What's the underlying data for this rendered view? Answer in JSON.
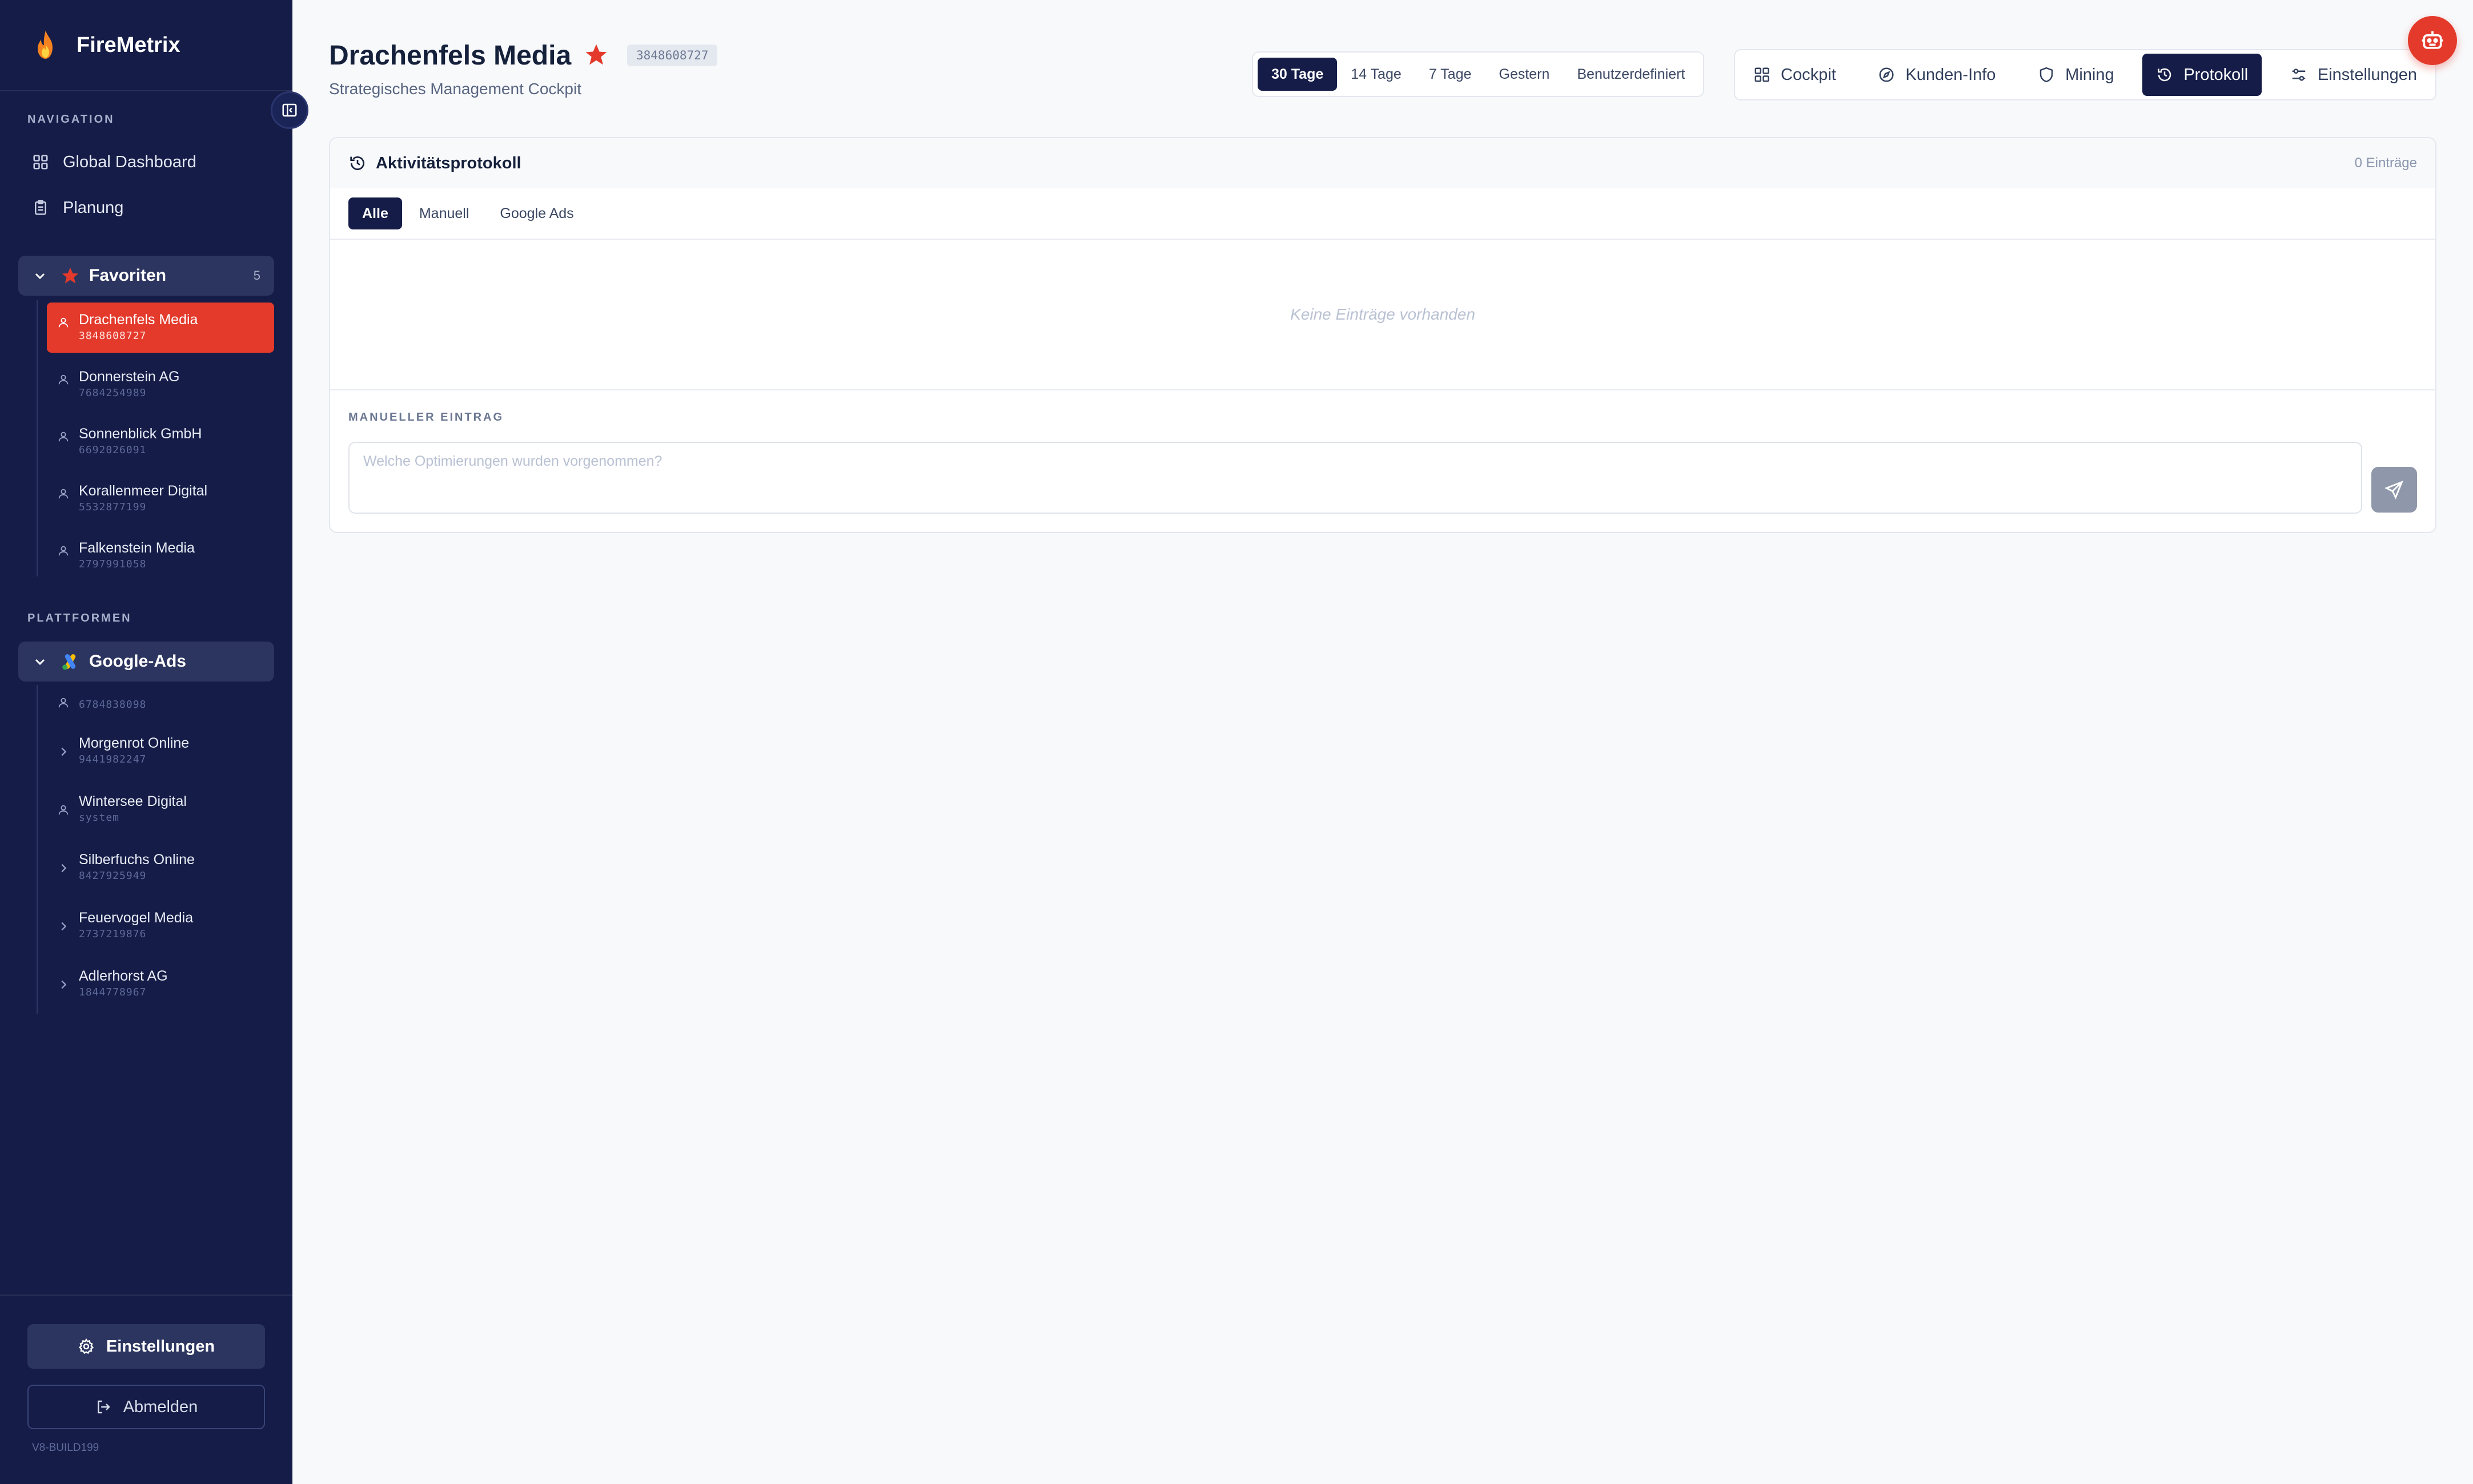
{
  "app": {
    "name": "FireMetrix",
    "build": "V8-BUILD199"
  },
  "sidebar": {
    "navigation_label": "NAVIGATION",
    "nav": [
      {
        "label": "Global Dashboard",
        "icon": "grid-icon"
      },
      {
        "label": "Planung",
        "icon": "clipboard-icon"
      }
    ],
    "favorites": {
      "title": "Favoriten",
      "count": "5",
      "items": [
        {
          "name": "Drachenfels Media",
          "id": "3848608727",
          "active": true
        },
        {
          "name": "Donnerstein AG",
          "id": "7684254989"
        },
        {
          "name": "Sonnenblick GmbH",
          "id": "6692026091"
        },
        {
          "name": "Korallenmeer Digital",
          "id": "5532877199"
        },
        {
          "name": "Falkenstein Media",
          "id": "2797991058"
        }
      ]
    },
    "platforms_label": "PLATTFORMEN",
    "google_ads": {
      "title": "Google-Ads",
      "items": [
        {
          "name": "",
          "id": "6784838098",
          "icon": "user-icon"
        },
        {
          "name": "Morgenrot Online",
          "id": "9441982247",
          "icon": "chevron-right-icon"
        },
        {
          "name": "Wintersee Digital",
          "id": "system",
          "icon": "user-icon"
        },
        {
          "name": "Silberfuchs Online",
          "id": "8427925949",
          "icon": "chevron-right-icon"
        },
        {
          "name": "Feuervogel Media",
          "id": "2737219876",
          "icon": "chevron-right-icon"
        },
        {
          "name": "Adlerhorst AG",
          "id": "1844778967",
          "icon": "chevron-right-icon"
        }
      ]
    },
    "footer": {
      "settings_label": "Einstellungen",
      "logout_label": "Abmelden"
    }
  },
  "header": {
    "title": "Drachenfels Media",
    "account_id": "3848608727",
    "subtitle": "Strategisches Management Cockpit",
    "ranges": [
      {
        "label": "30 Tage",
        "active": true
      },
      {
        "label": "14 Tage"
      },
      {
        "label": "7 Tage"
      },
      {
        "label": "Gestern"
      },
      {
        "label": "Benutzerdefiniert"
      }
    ],
    "tabs": [
      {
        "label": "Cockpit",
        "icon": "grid-icon"
      },
      {
        "label": "Kunden-Info",
        "icon": "compass-icon"
      },
      {
        "label": "Mining",
        "icon": "shield-icon"
      },
      {
        "label": "Protokoll",
        "icon": "history-icon",
        "active": true
      },
      {
        "label": "Einstellungen",
        "icon": "sliders-icon"
      }
    ]
  },
  "protocol": {
    "title": "Aktivitätsprotokoll",
    "entry_count": "0 Einträge",
    "filters": [
      {
        "label": "Alle",
        "active": true
      },
      {
        "label": "Manuell"
      },
      {
        "label": "Google Ads"
      }
    ],
    "empty_text": "Keine Einträge vorhanden",
    "manual_label": "MANUELLER EINTRAG",
    "manual_placeholder": "Welche Optimierungen wurden vorgenommen?",
    "manual_value": ""
  },
  "colors": {
    "accent": "#e33a2c",
    "navy": "#141c47",
    "background": "#f8f9fb"
  }
}
